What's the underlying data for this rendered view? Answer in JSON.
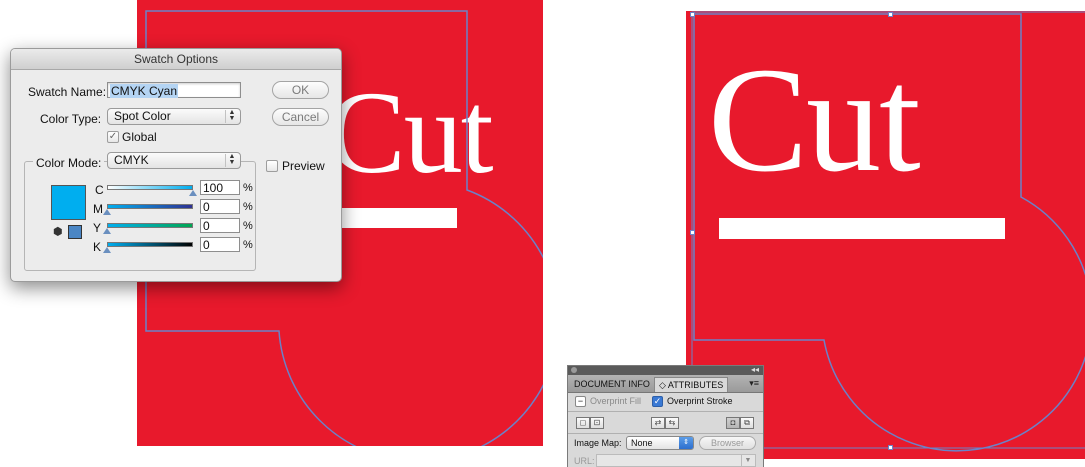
{
  "artwork": {
    "word": "Cut",
    "background_color": "#e8192c",
    "path_color": "#6b82c8"
  },
  "swatch_dialog": {
    "title": "Swatch Options",
    "swatch_name_label": "Swatch Name:",
    "swatch_name_value": "CMYK Cyan",
    "color_type_label": "Color Type:",
    "color_type_value": "Spot Color",
    "global_label": "Global",
    "global_checked": true,
    "color_mode_label": "Color Mode:",
    "color_mode_value": "CMYK",
    "ok_label": "OK",
    "cancel_label": "Cancel",
    "preview_label": "Preview",
    "preview_checked": false,
    "swatch_color": "#00aeef",
    "channels": [
      {
        "name": "C",
        "value": "100",
        "unit": "%",
        "level": 1.0,
        "gradient": [
          "#ffffff",
          "#00aeef"
        ]
      },
      {
        "name": "M",
        "value": "0",
        "unit": "%",
        "level": 0.0,
        "gradient": [
          "#00aeef",
          "#2e3192"
        ]
      },
      {
        "name": "Y",
        "value": "0",
        "unit": "%",
        "level": 0.0,
        "gradient": [
          "#00aeef",
          "#00a651"
        ]
      },
      {
        "name": "K",
        "value": "0",
        "unit": "%",
        "level": 0.0,
        "gradient": [
          "#00aeef",
          "#000000"
        ]
      }
    ]
  },
  "attributes_panel": {
    "tab_document_info": "DOCUMENT INFO",
    "tab_attributes": "◇ ATTRIBUTES",
    "overprint_fill_label": "Overprint Fill",
    "overprint_fill_checked": false,
    "overprint_stroke_label": "Overprint Stroke",
    "overprint_stroke_checked": true,
    "image_map_label": "Image Map:",
    "image_map_value": "None",
    "browser_label": "Browser",
    "url_label": "URL:"
  }
}
